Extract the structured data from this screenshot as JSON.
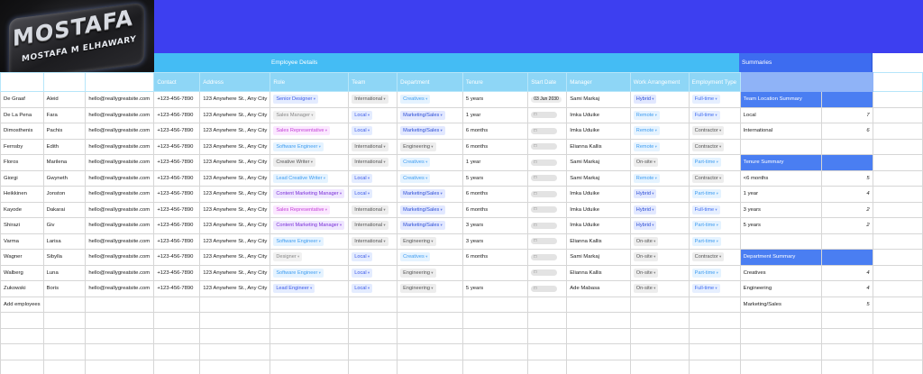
{
  "logo": {
    "line1": "MOSTAFA",
    "line2": "MOSTAFA M ELHAWARY"
  },
  "section_employee": "Employee Details",
  "section_summaries": "Summaries",
  "headers": [
    "Contact",
    "Address",
    "Role",
    "Team",
    "Department",
    "Tenure",
    "Start Date",
    "Manager",
    "Work Arrangement",
    "Employment Type"
  ],
  "rows": [
    {
      "last": "De Graaf",
      "first": "Aleid",
      "email": "hello@reallygreatsite.com",
      "phone": "+123-456-7890",
      "address": "123 Anywhere St., Any City",
      "role": "Senior Designer",
      "role_c": "c-blue",
      "team": "International",
      "team_c": "c-gray",
      "dept": "Creatives",
      "dept_c": "c-sky",
      "tenure": "5 years",
      "start": "03 Jun 2030",
      "start_on": true,
      "manager": "Sami Markaj",
      "arr": "Hybrid",
      "arr_c": "c-dblue",
      "emp": "Full-time",
      "emp_c": "c-cblue"
    },
    {
      "last": "De La Pena",
      "first": "Fara",
      "email": "hello@reallygreatsite.com",
      "phone": "+123-456-7890",
      "address": "123 Anywhere St., Any City",
      "role": "Sales Manager",
      "role_c": "c-lgray",
      "team": "Local",
      "team_c": "c-blue",
      "dept": "Marketing/Sales",
      "dept_c": "c-dblue",
      "tenure": "1 year",
      "start": "",
      "start_on": false,
      "manager": "Imka Uduike",
      "arr": "Remote",
      "arr_c": "c-sky",
      "emp": "Full-time",
      "emp_c": "c-cblue"
    },
    {
      "last": "Dimosthenis",
      "first": "Pachis",
      "email": "hello@reallygreatsite.com",
      "phone": "+123-456-7890",
      "address": "123 Anywhere St., Any City",
      "role": "Sales Representative",
      "role_c": "c-pink",
      "team": "Local",
      "team_c": "c-blue",
      "dept": "Marketing/Sales",
      "dept_c": "c-dblue",
      "tenure": "6 months",
      "start": "",
      "start_on": false,
      "manager": "Imka Uduike",
      "arr": "Remote",
      "arr_c": "c-sky",
      "emp": "Contractor",
      "emp_c": "c-gray"
    },
    {
      "last": "Fernsby",
      "first": "Edith",
      "email": "hello@reallygreatsite.com",
      "phone": "+123-456-7890",
      "address": "123 Anywhere St., Any City",
      "role": "Software Engineer",
      "role_c": "c-sky",
      "team": "International",
      "team_c": "c-gray",
      "dept": "Engineering",
      "dept_c": "c-gray",
      "tenure": "6 months",
      "start": "",
      "start_on": false,
      "manager": "Elianna Kallis",
      "arr": "Remote",
      "arr_c": "c-sky",
      "emp": "Contractor",
      "emp_c": "c-gray"
    },
    {
      "last": "Floros",
      "first": "Marilena",
      "email": "hello@reallygreatsite.com",
      "phone": "+123-456-7890",
      "address": "123 Anywhere St., Any City",
      "role": "Creative Writer",
      "role_c": "c-gray",
      "team": "International",
      "team_c": "c-gray",
      "dept": "Creatives",
      "dept_c": "c-sky",
      "tenure": "1 year",
      "start": "",
      "start_on": false,
      "manager": "Sami Markaj",
      "arr": "On-site",
      "arr_c": "c-gray",
      "emp": "Part-time",
      "emp_c": "c-sky"
    },
    {
      "last": "Giorgi",
      "first": "Gwyneth",
      "email": "hello@reallygreatsite.com",
      "phone": "+123-456-7890",
      "address": "123 Anywhere St., Any City",
      "role": "Lead Creative Writer",
      "role_c": "c-sky",
      "team": "Local",
      "team_c": "c-blue",
      "dept": "Creatives",
      "dept_c": "c-sky",
      "tenure": "5 years",
      "start": "",
      "start_on": false,
      "manager": "Sami Markaj",
      "arr": "Remote",
      "arr_c": "c-sky",
      "emp": "Contractor",
      "emp_c": "c-gray"
    },
    {
      "last": "Heikkinen",
      "first": "Jonston",
      "email": "hello@reallygreatsite.com",
      "phone": "+123-456-7890",
      "address": "123 Anywhere St., Any City",
      "role": "Content Marketing Manager",
      "role_c": "c-purple",
      "team": "Local",
      "team_c": "c-blue",
      "dept": "Marketing/Sales",
      "dept_c": "c-dblue",
      "tenure": "6 months",
      "start": "",
      "start_on": false,
      "manager": "Imka Uduike",
      "arr": "Hybrid",
      "arr_c": "c-dblue",
      "emp": "Part-time",
      "emp_c": "c-sky"
    },
    {
      "last": "Kayode",
      "first": "Dakarai",
      "email": "hello@reallygreatsite.com",
      "phone": "+123-456-7890",
      "address": "123 Anywhere St., Any City",
      "role": "Sales Representative",
      "role_c": "c-pink",
      "team": "International",
      "team_c": "c-gray",
      "dept": "Marketing/Sales",
      "dept_c": "c-dblue",
      "tenure": "6 months",
      "start": "",
      "start_on": false,
      "manager": "Imka Uduike",
      "arr": "Hybrid",
      "arr_c": "c-dblue",
      "emp": "Full-time",
      "emp_c": "c-cblue"
    },
    {
      "last": "Shirazi",
      "first": "Giv",
      "email": "hello@reallygreatsite.com",
      "phone": "+123-456-7890",
      "address": "123 Anywhere St., Any City",
      "role": "Content Marketing Manager",
      "role_c": "c-purple",
      "team": "International",
      "team_c": "c-gray",
      "dept": "Marketing/Sales",
      "dept_c": "c-dblue",
      "tenure": "3 years",
      "start": "",
      "start_on": false,
      "manager": "Imka Uduike",
      "arr": "Hybrid",
      "arr_c": "c-dblue",
      "emp": "Part-time",
      "emp_c": "c-sky"
    },
    {
      "last": "Varma",
      "first": "Larisa",
      "email": "hello@reallygreatsite.com",
      "phone": "+123-456-7890",
      "address": "123 Anywhere St., Any City",
      "role": "Software Engineer",
      "role_c": "c-sky",
      "team": "International",
      "team_c": "c-gray",
      "dept": "Engineering",
      "dept_c": "c-gray",
      "tenure": "3 years",
      "start": "",
      "start_on": false,
      "manager": "Elianna Kallis",
      "arr": "On-site",
      "arr_c": "c-gray",
      "emp": "Part-time",
      "emp_c": "c-sky"
    },
    {
      "last": "Wagner",
      "first": "Sibylla",
      "email": "hello@reallygreatsite.com",
      "phone": "+123-456-7890",
      "address": "123 Anywhere St., Any City",
      "role": "Designer",
      "role_c": "c-lgray",
      "team": "Local",
      "team_c": "c-blue",
      "dept": "Creatives",
      "dept_c": "c-sky",
      "tenure": "6 months",
      "start": "",
      "start_on": false,
      "manager": "Sami Markaj",
      "arr": "On-site",
      "arr_c": "c-gray",
      "emp": "Contractor",
      "emp_c": "c-gray"
    },
    {
      "last": "Walberg",
      "first": "Luna",
      "email": "hello@reallygreatsite.com",
      "phone": "+123-456-7890",
      "address": "123 Anywhere St., Any City",
      "role": "Software Engineer",
      "role_c": "c-sky",
      "team": "Local",
      "team_c": "c-blue",
      "dept": "Engineering",
      "dept_c": "c-gray",
      "tenure": "",
      "start": "",
      "start_on": false,
      "manager": "Elianna Kallis",
      "arr": "On-site",
      "arr_c": "c-gray",
      "emp": "Part-time",
      "emp_c": "c-sky"
    },
    {
      "last": "Zukowski",
      "first": "Boris",
      "email": "hello@reallygreatsite.com",
      "phone": "+123-456-7890",
      "address": "123 Anywhere St., Any City",
      "role": "Lead Engineer",
      "role_c": "c-blue",
      "team": "Local",
      "team_c": "c-blue",
      "dept": "Engineering",
      "dept_c": "c-gray",
      "tenure": "5 years",
      "start": "",
      "start_on": false,
      "manager": "Ade Mabasa",
      "arr": "On-site",
      "arr_c": "c-gray",
      "emp": "Full-time",
      "emp_c": "c-cblue"
    }
  ],
  "add_employees": "Add employees",
  "summary_right": [
    {
      "type": "band",
      "label": "Team Location Summary"
    },
    {
      "type": "val",
      "label": "Local",
      "value": "7"
    },
    {
      "type": "val",
      "label": "International",
      "value": "6"
    },
    {
      "type": "empty"
    },
    {
      "type": "band",
      "label": "Tenure Summary"
    },
    {
      "type": "val",
      "label": "<6 months",
      "value": "5"
    },
    {
      "type": "val",
      "label": "1 year",
      "value": "4"
    },
    {
      "type": "val",
      "label": "3 years",
      "value": "2"
    },
    {
      "type": "val",
      "label": "5 years",
      "value": "2"
    },
    {
      "type": "empty"
    },
    {
      "type": "band",
      "label": "Department Summary"
    },
    {
      "type": "val",
      "label": "Creatives",
      "value": "4"
    },
    {
      "type": "val",
      "label": "Engineering",
      "value": "4"
    },
    {
      "type": "val",
      "label": "Marketing/Sales",
      "value": "5"
    }
  ],
  "icons": {
    "calendar": "calendar-icon",
    "dropdown": "chevron-down-icon"
  }
}
